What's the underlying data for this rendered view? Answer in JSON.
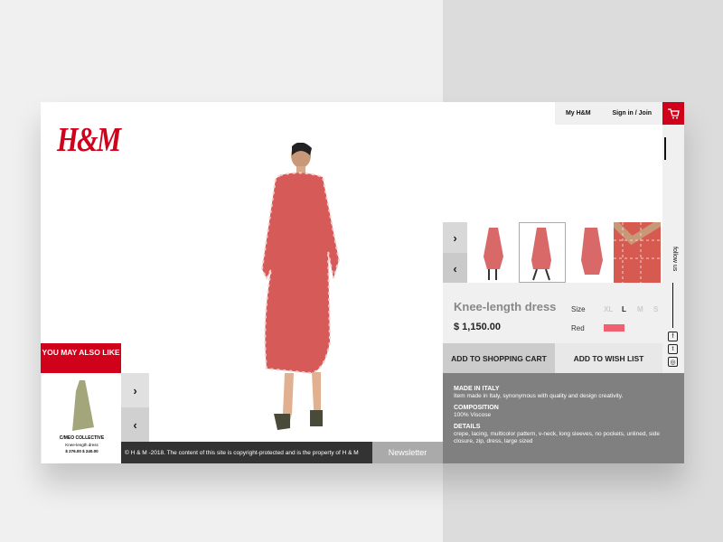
{
  "brand": {
    "logo": "H&M",
    "accent": "#d0021b"
  },
  "header": {
    "nav": [
      {
        "label": "My H&M"
      },
      {
        "label": "Sign in / Join"
      }
    ],
    "cart_icon": "shopping-cart-icon"
  },
  "sidebar": {
    "follow_label": "follow us",
    "social": [
      {
        "icon": "facebook-icon",
        "glyph": "f"
      },
      {
        "icon": "twitter-icon",
        "glyph": "t"
      },
      {
        "icon": "instagram-icon",
        "glyph": "◎"
      }
    ]
  },
  "gallery": {
    "next": "›",
    "prev": "‹",
    "thumbnails": 4,
    "selected": 2
  },
  "product": {
    "name": "Knee-length dress",
    "price": "$ 1,150.00",
    "size_label": "Size",
    "sizes": [
      "XL",
      "L",
      "M",
      "S"
    ],
    "selected_size": "L",
    "color_label": "Red",
    "color_swatch": "#f06070"
  },
  "actions": {
    "add_to_cart": "ADD TO SHOPPING CART",
    "add_to_wishlist": "ADD TO WISH LIST"
  },
  "details": [
    {
      "title": "MADE IN ITALY",
      "text": "Item made in Italy, synonymous with quality and design creativity."
    },
    {
      "title": "COMPOSITION",
      "text": "100% Viscose"
    },
    {
      "title": "DETAILS",
      "text": "crepe, lacing, multicolor pattern, v-neck, long sleeves, no pockets, unlined, side closure, zip, dress, large sized"
    }
  ],
  "recommend": {
    "title": "YOU MAY ALSO LIKE",
    "item": {
      "brand": "C/MEO COLLECTIVE",
      "name": "Knee-length dress",
      "price": "$ 276.00 $ 240.00"
    },
    "next": "›",
    "prev": "‹"
  },
  "footer": {
    "copyright": "© H & M -2018. The content of this site is copyright-protected and is the property of H & M",
    "newsletter": "Newsletter"
  }
}
